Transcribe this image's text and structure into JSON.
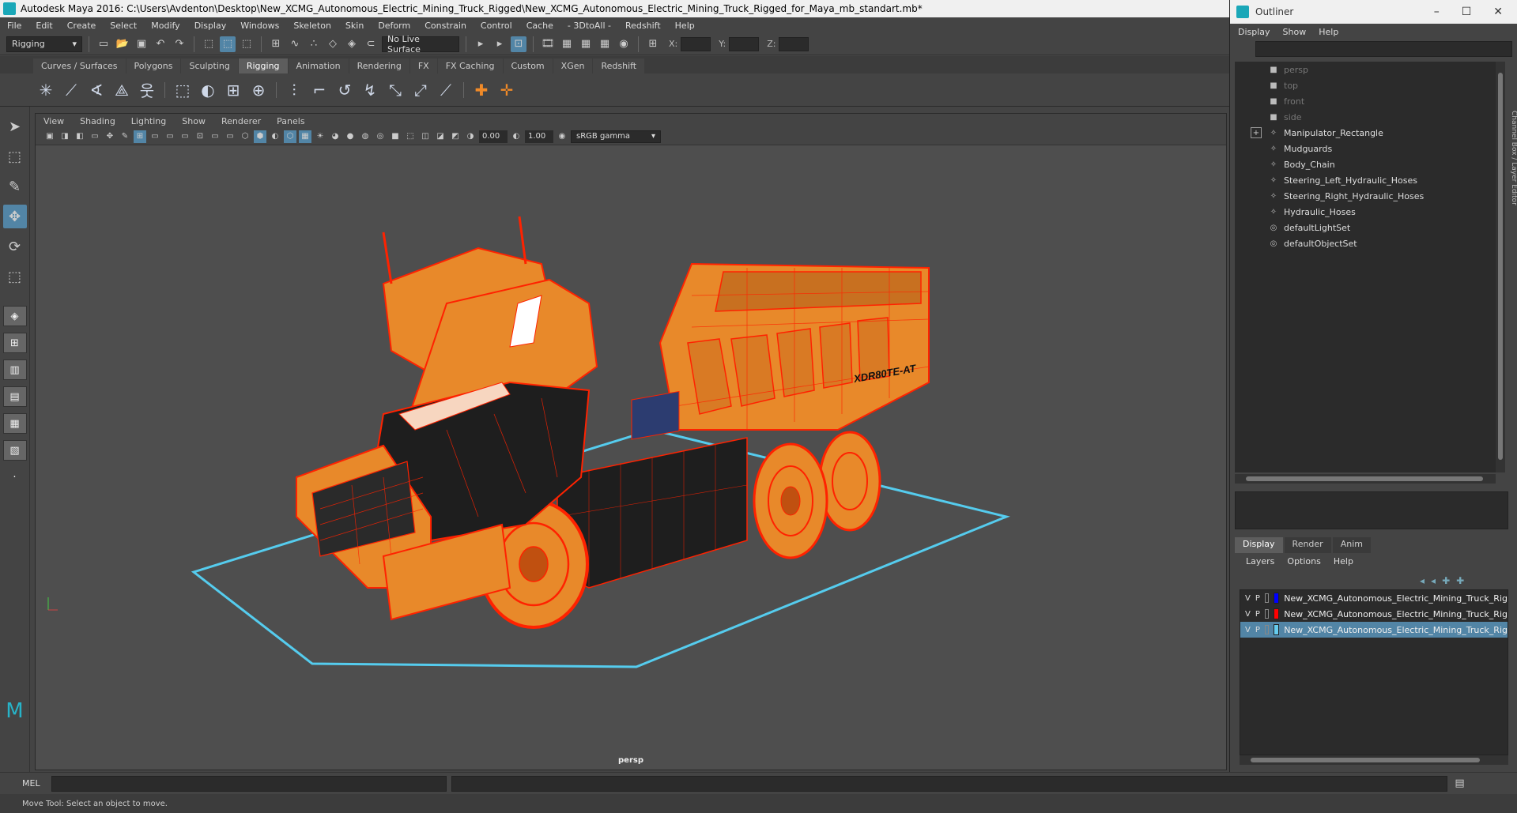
{
  "window": {
    "title": "Autodesk Maya 2016: C:\\Users\\Avdenton\\Desktop\\New_XCMG_Autonomous_Electric_Mining_Truck_Rigged\\New_XCMG_Autonomous_Electric_Mining_Truck_Rigged_for_Maya_mb_standart.mb*"
  },
  "menubar": [
    "File",
    "Edit",
    "Create",
    "Select",
    "Modify",
    "Display",
    "Windows",
    "Skeleton",
    "Skin",
    "Deform",
    "Constrain",
    "Control",
    "Cache",
    "- 3DtoAll -",
    "Redshift",
    "Help"
  ],
  "statusline": {
    "menuset": "Rigging",
    "live_surface": "No Live Surface",
    "x_label": "X:",
    "y_label": "Y:",
    "z_label": "Z:"
  },
  "shelf": {
    "tabs": [
      "Curves / Surfaces",
      "Polygons",
      "Sculpting",
      "Rigging",
      "Animation",
      "Rendering",
      "FX",
      "FX Caching",
      "Custom",
      "XGen",
      "Redshift"
    ],
    "active_tab": "Rigging"
  },
  "viewport": {
    "menu": [
      "View",
      "Shading",
      "Lighting",
      "Show",
      "Renderer",
      "Panels"
    ],
    "exposure": "0.00",
    "gamma": "1.00",
    "color_space": "sRGB gamma",
    "camera": "persp",
    "decal_model": "XDR80TE-AT"
  },
  "outliner": {
    "title": "Outliner",
    "menu": [
      "Display",
      "Show",
      "Help"
    ],
    "items": [
      {
        "label": "persp",
        "icon": "camera-icon",
        "dim": true
      },
      {
        "label": "top",
        "icon": "camera-icon",
        "dim": true
      },
      {
        "label": "front",
        "icon": "camera-icon",
        "dim": true
      },
      {
        "label": "side",
        "icon": "camera-icon",
        "dim": true
      },
      {
        "label": "Manipulator_Rectangle",
        "icon": "curve-icon",
        "dim": false,
        "expandable": true
      },
      {
        "label": "Mudguards",
        "icon": "curve-icon",
        "dim": false
      },
      {
        "label": "Body_Chain",
        "icon": "curve-icon",
        "dim": false
      },
      {
        "label": "Steering_Left_Hydraulic_Hoses",
        "icon": "curve-icon",
        "dim": false
      },
      {
        "label": "Steering_Right_Hydraulic_Hoses",
        "icon": "curve-icon",
        "dim": false
      },
      {
        "label": "Hydraulic_Hoses",
        "icon": "curve-icon",
        "dim": false
      },
      {
        "label": "defaultLightSet",
        "icon": "set-icon",
        "dim": false
      },
      {
        "label": "defaultObjectSet",
        "icon": "set-icon",
        "dim": false
      }
    ],
    "side_tab": "Channel Box / Layer Editor"
  },
  "layer_editor": {
    "tabs": [
      "Display",
      "Render",
      "Anim"
    ],
    "active_tab": "Display",
    "menu": [
      "Layers",
      "Options",
      "Help"
    ],
    "layers": [
      {
        "v": "V",
        "p": "P",
        "color": "#0000ff",
        "name": "New_XCMG_Autonomous_Electric_Mining_Truck_Rig",
        "selected": false
      },
      {
        "v": "V",
        "p": "P",
        "color": "#ff0000",
        "name": "New_XCMG_Autonomous_Electric_Mining_Truck_Rig",
        "selected": false
      },
      {
        "v": "V",
        "p": "P",
        "color": "#66ccee",
        "name": "New_XCMG_Autonomous_Electric_Mining_Truck_Rig",
        "selected": true
      }
    ]
  },
  "commandline": {
    "label": "MEL"
  },
  "helpline": {
    "text": "Move Tool: Select an object to move."
  },
  "colors": {
    "accent": "#5285a6",
    "wireframe": "#ff2200",
    "body_orange": "#e8892a",
    "grid": "#55ccee"
  }
}
